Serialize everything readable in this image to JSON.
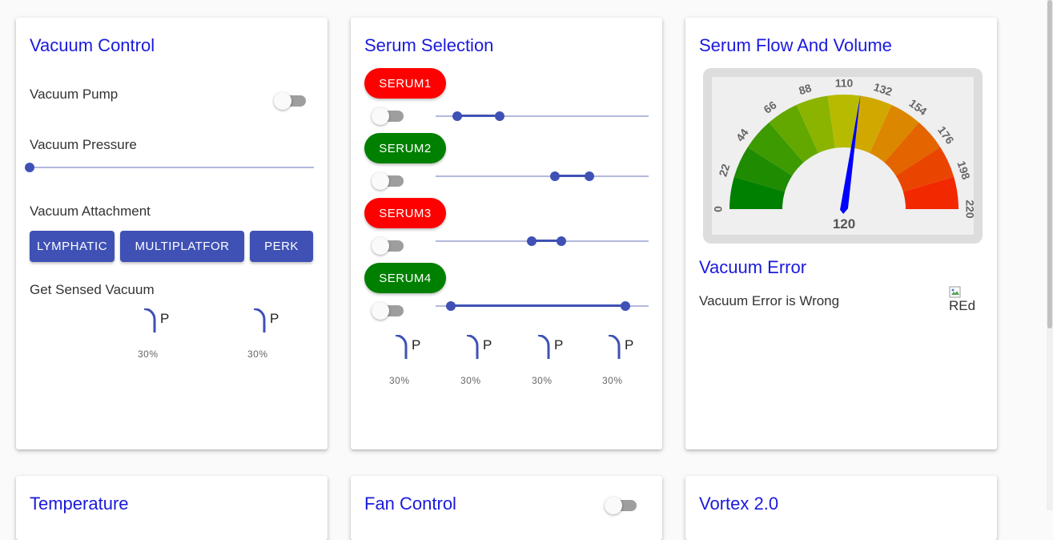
{
  "vacuum_control": {
    "title": "Vacuum Control",
    "pump_label": "Vacuum Pump",
    "pump_on": false,
    "pressure_label": "Vacuum Pressure",
    "pressure_value": 0,
    "attachment_label": "Vacuum Attachment",
    "attachments": [
      "LYMPHATIC",
      "MULTIPLATFOR",
      "PERK"
    ],
    "sensed_label": "Get Sensed Vacuum",
    "sensed": [
      {
        "letter": "P",
        "percent": "30%"
      },
      {
        "letter": "P",
        "percent": "30%"
      }
    ]
  },
  "serum_selection": {
    "title": "Serum Selection",
    "serums": [
      {
        "label": "SERUM1",
        "color": "#ff0000",
        "on": false,
        "range": [
          0.1,
          0.3
        ]
      },
      {
        "label": "SERUM2",
        "color": "#008000",
        "on": false,
        "range": [
          0.56,
          0.72
        ]
      },
      {
        "label": "SERUM3",
        "color": "#ff0000",
        "on": false,
        "range": [
          0.45,
          0.59
        ]
      },
      {
        "label": "SERUM4",
        "color": "#008000",
        "on": false,
        "range": [
          0.07,
          0.89
        ]
      }
    ],
    "indicators": [
      {
        "letter": "P",
        "percent": "30%"
      },
      {
        "letter": "P",
        "percent": "30%"
      },
      {
        "letter": "P",
        "percent": "30%"
      },
      {
        "letter": "P",
        "percent": "30%"
      }
    ]
  },
  "serum_flow": {
    "title": "Serum Flow And Volume",
    "gauge": {
      "min": 0,
      "max": 220,
      "value": 120,
      "value_label": "120",
      "ticks": [
        "0",
        "22",
        "44",
        "66",
        "88",
        "110",
        "132",
        "154",
        "176",
        "198",
        "220"
      ],
      "colors": [
        "#008000",
        "#1e8b00",
        "#3d9a00",
        "#62a800",
        "#8bb400",
        "#b7bb00",
        "#d1a800",
        "#dc8700",
        "#e46400",
        "#ea4500",
        "#f22800"
      ],
      "needle_color": "#0000ff"
    },
    "error_title": "Vacuum Error",
    "error_text": "Vacuum Error is Wrong",
    "error_image_alt": "REd"
  },
  "bottom_cards": {
    "temperature_title": "Temperature",
    "fan_title": "Fan Control",
    "vortex_title": "Vortex 2.0"
  },
  "theme": {
    "primary": "#3f51b5",
    "title_color": "#1a1adc"
  }
}
